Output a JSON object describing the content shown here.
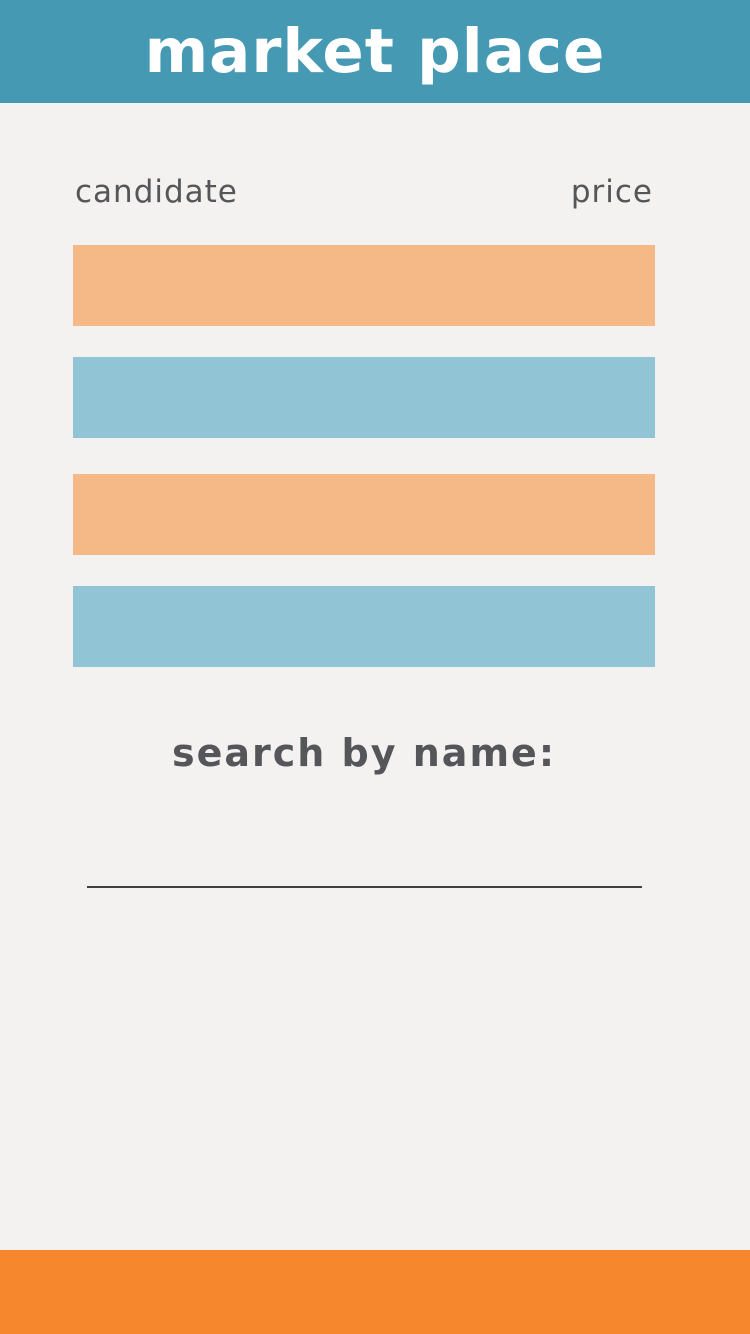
{
  "header": {
    "title": "market place",
    "color": "#4599b3"
  },
  "table": {
    "columns": [
      "candidate",
      "price"
    ],
    "rows": [
      {
        "candidate": "",
        "price": "",
        "color": "#f5b887"
      },
      {
        "candidate": "",
        "price": "",
        "color": "#91c4d5"
      },
      {
        "candidate": "",
        "price": "",
        "color": "#f5b887"
      },
      {
        "candidate": "",
        "price": "",
        "color": "#91c4d5"
      }
    ]
  },
  "search": {
    "label": "search by name:",
    "value": "",
    "placeholder": ""
  },
  "footer": {
    "color": "#f7872d"
  }
}
